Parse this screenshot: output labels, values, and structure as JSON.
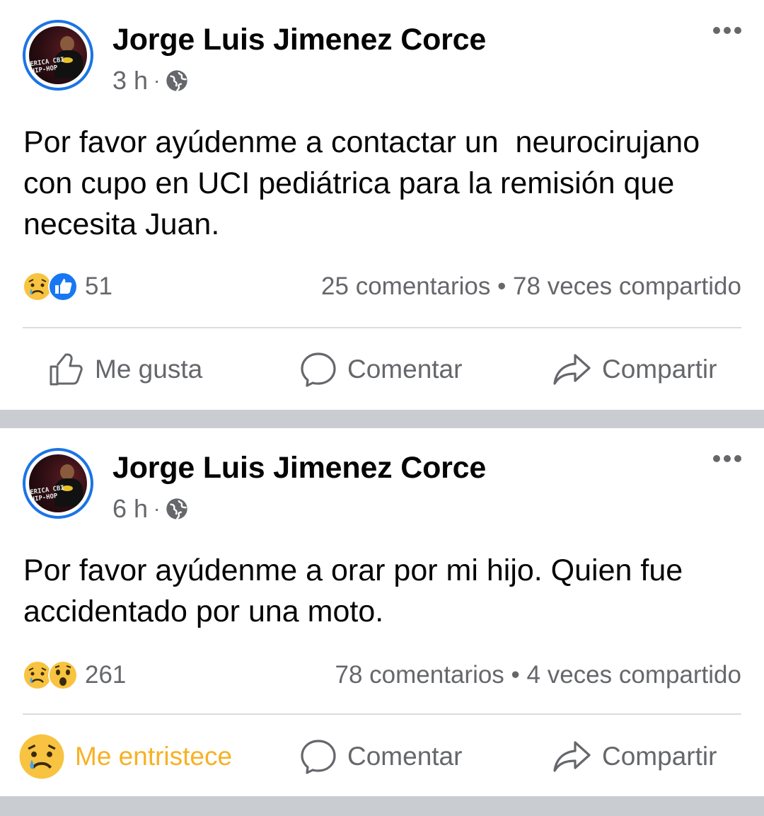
{
  "posts": [
    {
      "author": "Jorge Luis Jimenez Corce",
      "time": "3 h",
      "dot": "·",
      "text": "Por favor ayúdenme a contactar un  neurocirujano con cupo en UCI pediátrica para la remisión que necesita Juan.",
      "reactions": [
        "sad",
        "like"
      ],
      "reaction_count": "51",
      "counts": "25 comentarios • 78 veces compartido",
      "actions": {
        "like": "Me gusta",
        "comment": "Comentar",
        "share": "Compartir"
      }
    },
    {
      "author": "Jorge Luis Jimenez Corce",
      "time": "6 h",
      "dot": "·",
      "text": "Por favor ayúdenme a orar por mi hijo. Quien fue accidentado por una moto.",
      "reactions": [
        "sad",
        "wow"
      ],
      "reaction_count": "261",
      "counts": "78 comentarios • 4 veces compartido",
      "actions": {
        "like": "Me entristece",
        "comment": "Comentar",
        "share": "Compartir"
      }
    }
  ],
  "avatar_graffiti": "ERICA CBI\nHIP-HOP",
  "icons": [
    "globe-icon",
    "more-options-icon",
    "sad-reaction-icon",
    "like-reaction-icon",
    "wow-reaction-icon",
    "thumbs-up-icon",
    "comment-icon",
    "share-icon"
  ],
  "colors": {
    "blue": "#1b74e4",
    "gray": "#65676b",
    "sad_yellow": "#f7b125",
    "separator": "#c9ccd1"
  }
}
